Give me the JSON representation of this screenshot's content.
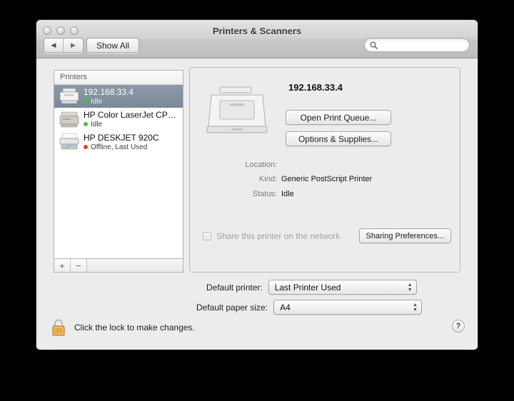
{
  "window": {
    "title": "Printers & Scanners",
    "traffic_lights": [
      "close",
      "minimize",
      "zoom"
    ]
  },
  "toolbar": {
    "back_label": "◀",
    "forward_label": "▶",
    "show_all_label": "Show All",
    "search_value": "",
    "search_placeholder": ""
  },
  "printer_list": {
    "header": "Printers",
    "add_label": "+",
    "remove_label": "−",
    "items": [
      {
        "name": "192.168.33.4",
        "status": "Idle",
        "status_color": "#44c23a",
        "selected": true,
        "icon": "laser-printer-icon"
      },
      {
        "name": "HP Color LaserJet CP…",
        "status": "Idle",
        "status_color": "#44c23a",
        "selected": false,
        "icon": "color-laserjet-icon"
      },
      {
        "name": "HP DESKJET 920C",
        "status": "Offline, Last Used",
        "status_color": "#e03b2f",
        "selected": false,
        "icon": "deskjet-icon"
      }
    ]
  },
  "detail": {
    "printer_name": "192.168.33.4",
    "open_queue_label": "Open Print Queue...",
    "options_label": "Options & Supplies...",
    "fields": [
      {
        "label": "Location:",
        "value": ""
      },
      {
        "label": "Kind:",
        "value": "Generic PostScript Printer"
      },
      {
        "label": "Status:",
        "value": "Idle"
      }
    ],
    "share_label": "Share this printer on the network",
    "share_checked": false,
    "sharing_prefs_label": "Sharing Preferences..."
  },
  "defaults": {
    "printer_label": "Default printer:",
    "printer_value": "Last Printer Used",
    "paper_label": "Default paper size:",
    "paper_value": "A4"
  },
  "footer": {
    "lock_text": "Click the lock to make changes.",
    "lock_state": "locked",
    "help_label": "?"
  },
  "colors": {
    "selection": "#8d9aaa",
    "window_bg": "#ececec",
    "lock_gold": "#e8a33d"
  }
}
